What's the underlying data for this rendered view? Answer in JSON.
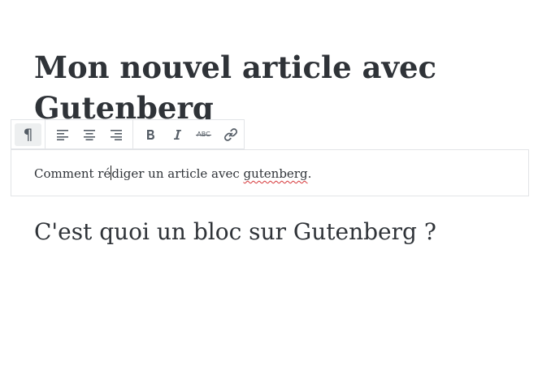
{
  "post": {
    "title": "Mon nouvel article avec Gutenberg"
  },
  "paragraph": {
    "text_before_caret": "Comment ré",
    "text_after_caret": "diger un article avec ",
    "misspelled_word": "gutenberg",
    "text_end": "."
  },
  "heading": {
    "text": "C'est quoi un bloc sur Gutenberg ?"
  },
  "toolbar": {
    "paragraph_glyph": "¶",
    "groups": [
      {
        "name": "block-type",
        "items": [
          "paragraph-icon"
        ]
      },
      {
        "name": "alignment",
        "items": [
          "align-left-icon",
          "align-center-icon",
          "align-right-icon"
        ]
      },
      {
        "name": "formatting",
        "items": [
          "bold-icon",
          "italic-icon",
          "strikethrough-icon",
          "link-icon"
        ]
      }
    ],
    "strikethrough_label": "ABC"
  },
  "colors": {
    "text": "#2f3338",
    "icon": "#555d66",
    "border": "#e2e4e7",
    "active_bg": "#edeff0",
    "spellcheck": "#d63638"
  }
}
